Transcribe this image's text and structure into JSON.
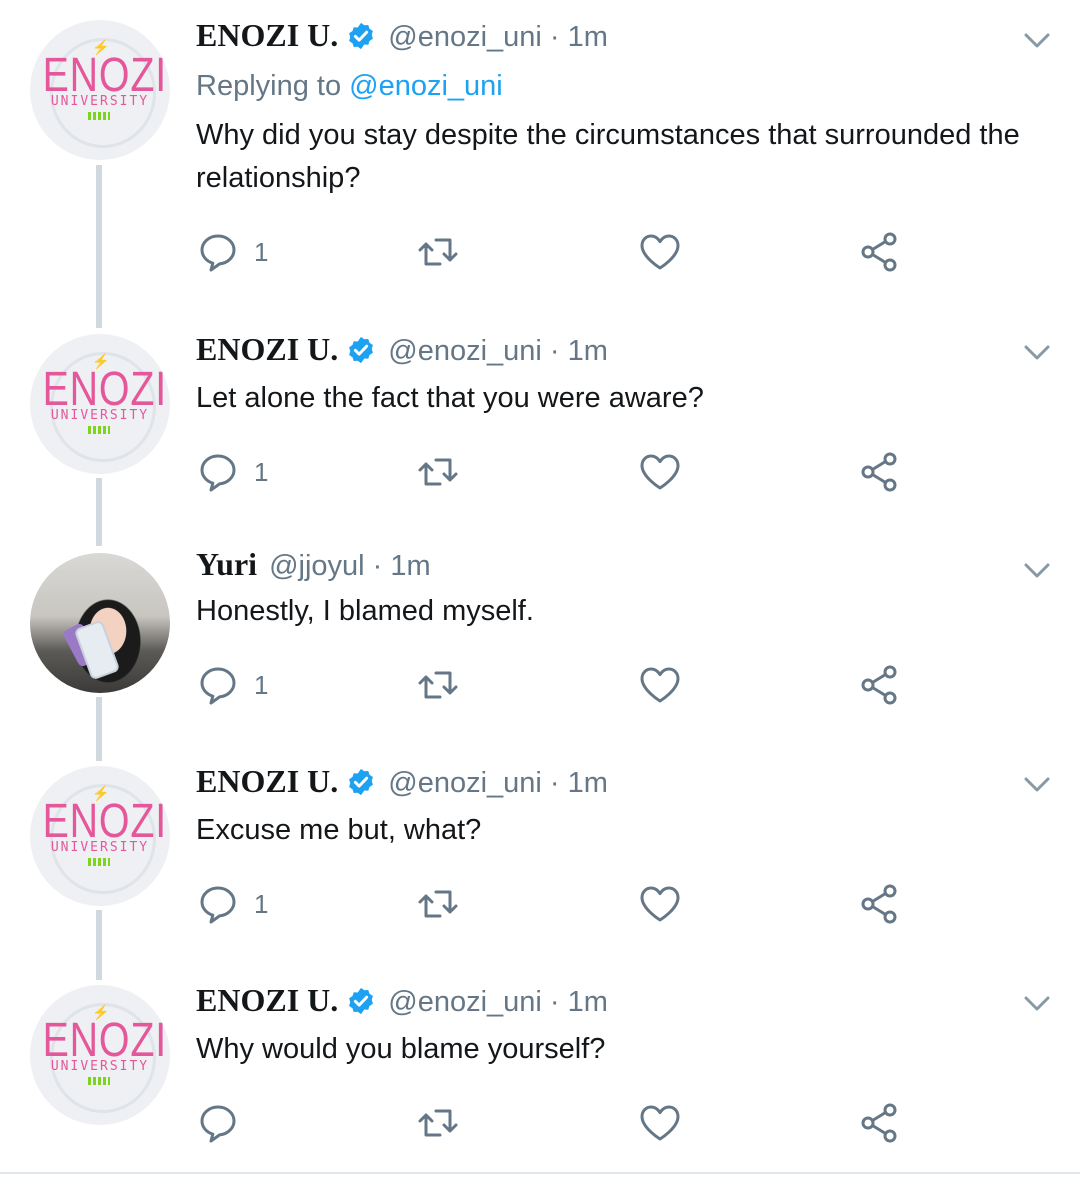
{
  "tweets": [
    {
      "name": "ENOZI U.",
      "verified": true,
      "handle": "@enozi_uni",
      "time": "1m",
      "reply_prefix": "Replying to",
      "reply_handle": "@enozi_uni",
      "text": "Why did you stay despite the circumstances that surrounded the relationship?",
      "reply_count": "1",
      "avatar": "enozi-logo"
    },
    {
      "name": "ENOZI U.",
      "verified": true,
      "handle": "@enozi_uni",
      "time": "1m",
      "text": "Let alone the fact that you were aware?",
      "reply_count": "1",
      "avatar": "enozi-logo"
    },
    {
      "name": "Yuri",
      "verified": false,
      "handle": "@jjoyul",
      "time": "1m",
      "text": "Honestly, I blamed myself.",
      "reply_count": "1",
      "avatar": "user-photo"
    },
    {
      "name": "ENOZI U.",
      "verified": true,
      "handle": "@enozi_uni",
      "time": "1m",
      "text": "Excuse me but, what?",
      "reply_count": "1",
      "avatar": "enozi-logo"
    },
    {
      "name": "ENOZI U.",
      "verified": true,
      "handle": "@enozi_uni",
      "time": "1m",
      "text": "Why would you blame yourself?",
      "reply_count": "",
      "avatar": "enozi-logo"
    }
  ],
  "logo": {
    "word": "ENOZI",
    "sub": "UNIVERSITY"
  },
  "colors": {
    "accent": "#1da1f2",
    "muted": "#657786",
    "logo_pink": "#e4589b",
    "logo_green": "#7ed321",
    "thread_line": "#cfd9de"
  },
  "icons": [
    "reply-icon",
    "retweet-icon",
    "like-icon",
    "share-icon",
    "chevron-down-icon",
    "verified-badge-icon"
  ]
}
